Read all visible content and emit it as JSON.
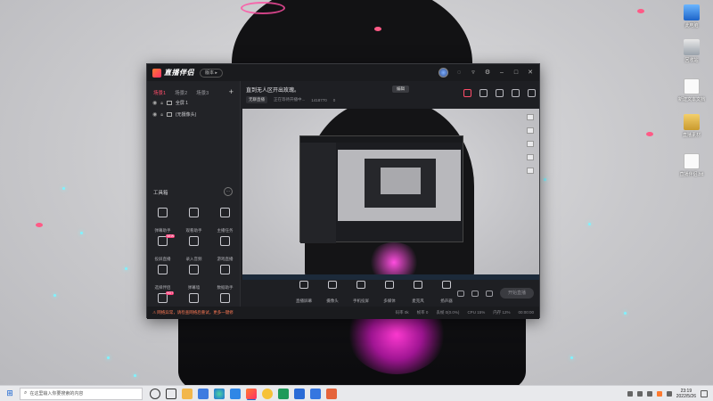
{
  "desktop": {
    "icons": [
      {
        "label": "此电脑",
        "kind": "pc"
      },
      {
        "label": "回收站",
        "kind": "bin"
      },
      {
        "label": "新建文本文档",
        "kind": "doc"
      },
      {
        "label": "直播素材",
        "kind": "folder"
      },
      {
        "label": "直播伴侣.txt",
        "kind": "doc"
      }
    ]
  },
  "app": {
    "logo_text": "直播伴侣",
    "version_pill": "版本 ▸",
    "title_buttons": [
      "feedback",
      "settings",
      "minimize",
      "maximize",
      "close"
    ],
    "scene_tabs": [
      "场景1",
      "场景2",
      "场景3"
    ],
    "add_label": "+",
    "sources": [
      "全屏 1",
      "(无摄像头)"
    ],
    "toolbox": {
      "title": "工具箱",
      "more": "···",
      "tools": [
        {
          "label": "弹幕助手",
          "badge": ""
        },
        {
          "label": "观看助手",
          "badge": ""
        },
        {
          "label": "主播任务",
          "badge": ""
        },
        {
          "label": "投屏直播",
          "badge": "NEW"
        },
        {
          "label": "录入音频",
          "badge": ""
        },
        {
          "label": "游戏直播",
          "badge": ""
        },
        {
          "label": "选择伴侣",
          "badge": ""
        },
        {
          "label": "弹幕墙",
          "badge": ""
        },
        {
          "label": "数据助手",
          "badge": ""
        },
        {
          "label": "直播美颜",
          "badge": "HOT"
        },
        {
          "label": "互动玩法",
          "badge": ""
        },
        {
          "label": "其他",
          "badge": ""
        }
      ]
    },
    "room": {
      "title": "直到无人区开出玫瑰。",
      "edit": "编辑",
      "category": "无聊直播",
      "status": "正在等待开播中...",
      "id": "1418770",
      "likes": "0"
    },
    "bottom_tools": [
      "直播屏幕",
      "摄像头",
      "手机投屏",
      "多媒体",
      "麦克风",
      "扬声器"
    ],
    "go_live": "开始直播",
    "status": {
      "warning": "⚠ 网络异常，请检查网络后重试，更多一键修",
      "stats": [
        "码率 0k",
        "帧率 0",
        "丢帧 0(0.0%)",
        "CPU 15%",
        "内存 12%",
        "00:00:00"
      ]
    }
  },
  "taskbar": {
    "search_placeholder": "在这里输入你要搜索的内容",
    "time": "23:19",
    "date": "2022/5/26"
  }
}
